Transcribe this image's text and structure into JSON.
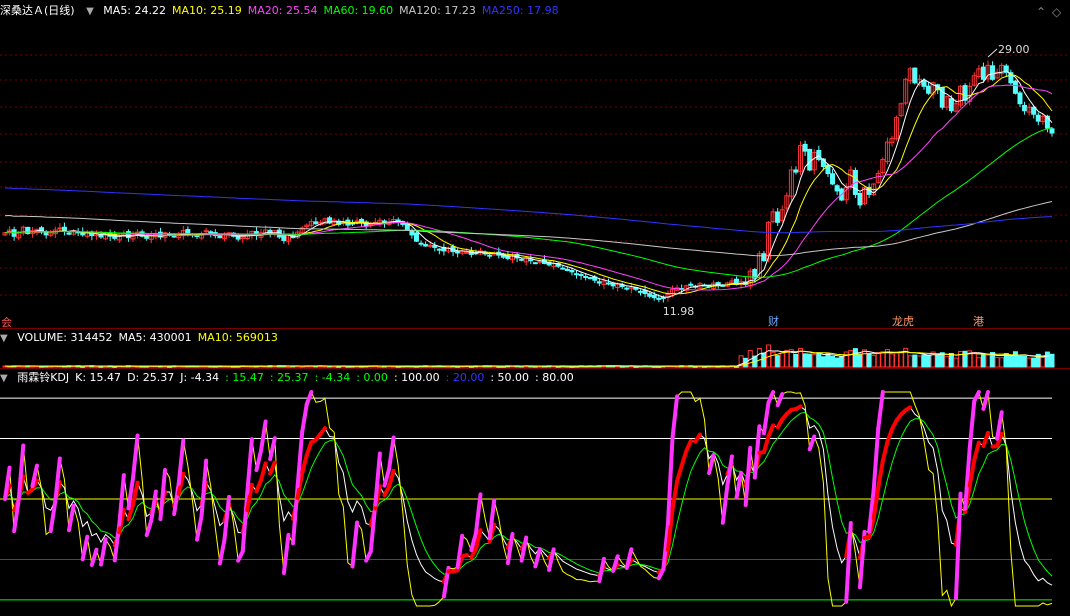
{
  "main_panel": {
    "title": "深桑达Ａ(日线)",
    "indicators": [
      {
        "label": "MA5: 24.22",
        "color": "#ffffff"
      },
      {
        "label": "MA10: 25.19",
        "color": "#ffff00"
      },
      {
        "label": "MA20: 25.54",
        "color": "#ff44ff"
      },
      {
        "label": "MA60: 19.60",
        "color": "#00ff00"
      },
      {
        "label": "MA120: 17.23",
        "color": "#c8c8c8"
      },
      {
        "label": "MA250: 17.98",
        "color": "#3333ff"
      }
    ],
    "high_label": "29.00",
    "low_label": "11.98",
    "event_tags": [
      {
        "text": "财",
        "color": "#66aaff"
      },
      {
        "text": "龙虎",
        "color": "#ff9966"
      },
      {
        "text": "港",
        "color": "#ff9966"
      }
    ],
    "left_tag": "会"
  },
  "volume_panel": {
    "labels": [
      {
        "label": "VOLUME: 314452",
        "color": "#ffffff"
      },
      {
        "label": "MA5: 430001",
        "color": "#ffffff"
      },
      {
        "label": "MA10: 569013",
        "color": "#ffff00"
      }
    ]
  },
  "kdj_panel": {
    "labels": [
      {
        "label": "雨霖铃KDJ",
        "color": "#ffffff"
      },
      {
        "label": "K: 15.47",
        "color": "#ffffff"
      },
      {
        "label": "D: 25.37",
        "color": "#ffffff"
      },
      {
        "label": "J: -4.34",
        "color": "#ffffff"
      },
      {
        "label": ": 15.47",
        "color": "#00ff00"
      },
      {
        "label": ": 25.37",
        "color": "#00ff00"
      },
      {
        "label": ": -4.34",
        "color": "#00ff00"
      },
      {
        "label": ": 0.00",
        "color": "#00ff00"
      },
      {
        "label": ": 100.00",
        "color": "#ffffff"
      },
      {
        "label": ": 20.00",
        "color": "#3333ff"
      },
      {
        "label": ": 50.00",
        "color": "#ffffff"
      },
      {
        "label": ": 80.00",
        "color": "#ffffff"
      }
    ]
  },
  "colors": {
    "up": "#ff3232",
    "down": "#54ffff",
    "grid": "#7a0000",
    "background": "#000000"
  },
  "chart_data": {
    "type": "line",
    "series_close": [
      21.5,
      21.9,
      21.0,
      21.6,
      22.3,
      21.4,
      21.8,
      22.0,
      21.6,
      21.2,
      21.5,
      21.9,
      22.2,
      21.7,
      21.3,
      21.8,
      21.5,
      21.2,
      21.6,
      21.1,
      21.4,
      20.9,
      21.2,
      21.0,
      20.7,
      21.1,
      21.4,
      20.8,
      21.2,
      21.6,
      21.0,
      20.7,
      21.1,
      21.3,
      20.9,
      21.5,
      21.2,
      20.9,
      21.3,
      21.8,
      21.4,
      21.2,
      21.0,
      21.4,
      21.8,
      21.3,
      21.1,
      20.8,
      21.2,
      21.5,
      21.0,
      20.6,
      20.9,
      21.3,
      21.7,
      21.1,
      21.5,
      21.9,
      21.3,
      21.8,
      20.9,
      20.4,
      21.2,
      20.8,
      21.6,
      22.2,
      22.6,
      23.1,
      22.8,
      23.0,
      23.5,
      22.9,
      23.3,
      22.7,
      23.1,
      22.6,
      22.8,
      23.2,
      22.9,
      22.5,
      22.7,
      23.0,
      23.3,
      22.8,
      23.1,
      23.4,
      23.0,
      22.7,
      21.9,
      21.2,
      20.3,
      19.9,
      19.6,
      19.7,
      19.4,
      19.1,
      18.9,
      19.3,
      18.8,
      18.6,
      18.9,
      18.7,
      18.4,
      18.6,
      18.9,
      18.5,
      18.2,
      18.6,
      18.3,
      18.0,
      17.8,
      18.2,
      17.9,
      17.6,
      17.9,
      17.5,
      17.2,
      17.4,
      17.1,
      16.9,
      17.1,
      16.7,
      16.4,
      16.1,
      15.9,
      15.6,
      15.4,
      15.2,
      15.0,
      14.7,
      14.3,
      14.6,
      14.2,
      13.9,
      14.1,
      13.8,
      13.5,
      13.7,
      13.4,
      13.1,
      12.8,
      12.4,
      12.2,
      11.98,
      12.1,
      12.7,
      13.4,
      13.6,
      13.5,
      13.9,
      14.1,
      13.8,
      14.2,
      14.0,
      13.8,
      14.3,
      14.0,
      13.9,
      14.3,
      14.6,
      14.1,
      14.5,
      14.1,
      16.0,
      15.0,
      18.5,
      17.5,
      23.0,
      24.5,
      23.0,
      24.8,
      26.8,
      30.5,
      30.2,
      34.0,
      33.2,
      30.5,
      33.0,
      32.0,
      31.0,
      30.0,
      28.5,
      27.5,
      26.2,
      28.0,
      30.5,
      27.0,
      25.5,
      28.0,
      27.0,
      28.5,
      30.0,
      32.0,
      34.5,
      35.0,
      38.0,
      40.0,
      43.5,
      45.0,
      43.0,
      43.5,
      42.5,
      41.5,
      43.0,
      42.0,
      39.5,
      41.0,
      39.0,
      40.0,
      42.5,
      40.5,
      42.5,
      44.0,
      45.0,
      43.5,
      45.5,
      43.5,
      44.5,
      45.5,
      44.5,
      43.0,
      41.5,
      40.0,
      39.0,
      39.5,
      38.5,
      37.5,
      38.2,
      36.5,
      35.8
    ],
    "yrange": [
      9.0,
      52.0
    ],
    "kdj_levels": [
      0,
      20,
      50,
      80,
      100
    ],
    "kdj_range": [
      -5,
      105
    ]
  }
}
